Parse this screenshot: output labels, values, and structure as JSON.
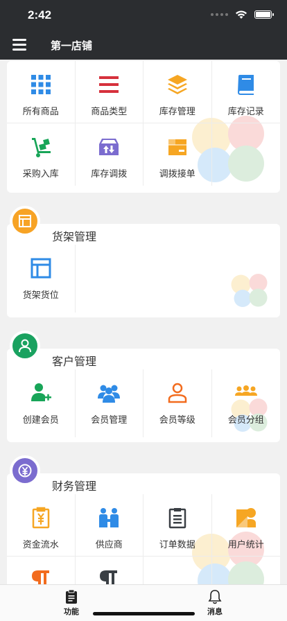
{
  "status": {
    "time": "2:42"
  },
  "header": {
    "title": "第一店铺"
  },
  "inventory": {
    "items": [
      {
        "label": "所有商品",
        "icon": "grid-icon"
      },
      {
        "label": "商品类型",
        "icon": "list-icon"
      },
      {
        "label": "库存管理",
        "icon": "layers-icon"
      },
      {
        "label": "库存记录",
        "icon": "book-icon"
      },
      {
        "label": "采购入库",
        "icon": "hand-truck-icon"
      },
      {
        "label": "库存调拨",
        "icon": "transfer-box-icon"
      },
      {
        "label": "调拨接单",
        "icon": "package-icon"
      }
    ]
  },
  "shelf": {
    "title": "货架管理",
    "color": "#f7a325",
    "items": [
      {
        "label": "货架货位",
        "icon": "shelf-layout-icon"
      }
    ]
  },
  "customer": {
    "title": "客户管理",
    "color": "#1aa260",
    "items": [
      {
        "label": "创建会员",
        "icon": "add-user-icon"
      },
      {
        "label": "会员管理",
        "icon": "users-group-icon"
      },
      {
        "label": "会员等级",
        "icon": "user-outline-icon"
      },
      {
        "label": "会员分组",
        "icon": "users-row-icon"
      }
    ]
  },
  "finance": {
    "title": "财务管理",
    "color": "#7b6ccf",
    "items": [
      {
        "label": "资金流水",
        "icon": "yuan-clipboard-icon"
      },
      {
        "label": "供应商",
        "icon": "supplier-icon"
      },
      {
        "label": "订单数据",
        "icon": "order-clipboard-icon"
      },
      {
        "label": "用户统计",
        "icon": "user-stats-icon"
      }
    ]
  },
  "tabs": [
    {
      "label": "功能",
      "icon": "clipboard-icon"
    },
    {
      "label": "消息",
      "icon": "bell-icon"
    }
  ]
}
